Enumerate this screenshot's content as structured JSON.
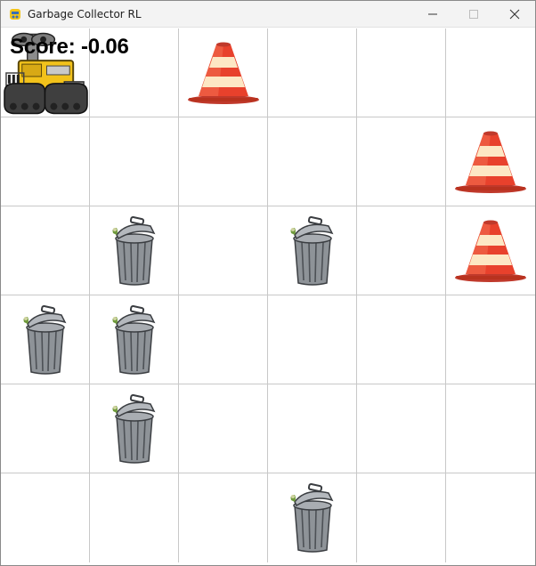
{
  "window": {
    "title": "Garbage Collector RL",
    "controls": {
      "minimize_icon": "minimize-icon",
      "maximize_icon": "maximize-icon",
      "close_icon": "close-icon"
    }
  },
  "score_text": "Score: -0.06",
  "grid": {
    "rows": 6,
    "cols": 6,
    "cells": [
      [
        "robot",
        "empty",
        "cone",
        "empty",
        "empty",
        "empty"
      ],
      [
        "empty",
        "empty",
        "empty",
        "empty",
        "empty",
        "cone"
      ],
      [
        "empty",
        "trash",
        "empty",
        "trash",
        "empty",
        "cone"
      ],
      [
        "trash",
        "trash",
        "empty",
        "empty",
        "empty",
        "empty"
      ],
      [
        "empty",
        "trash",
        "empty",
        "empty",
        "empty",
        "empty"
      ],
      [
        "empty",
        "empty",
        "empty",
        "trash",
        "empty",
        "empty"
      ]
    ]
  },
  "colors": {
    "cone_red": "#e8412c",
    "cone_stripe": "#fde7c4",
    "trash_gray": "#8e9398",
    "robot_yellow": "#f2c21b",
    "grid_line": "#c8c8c8"
  }
}
